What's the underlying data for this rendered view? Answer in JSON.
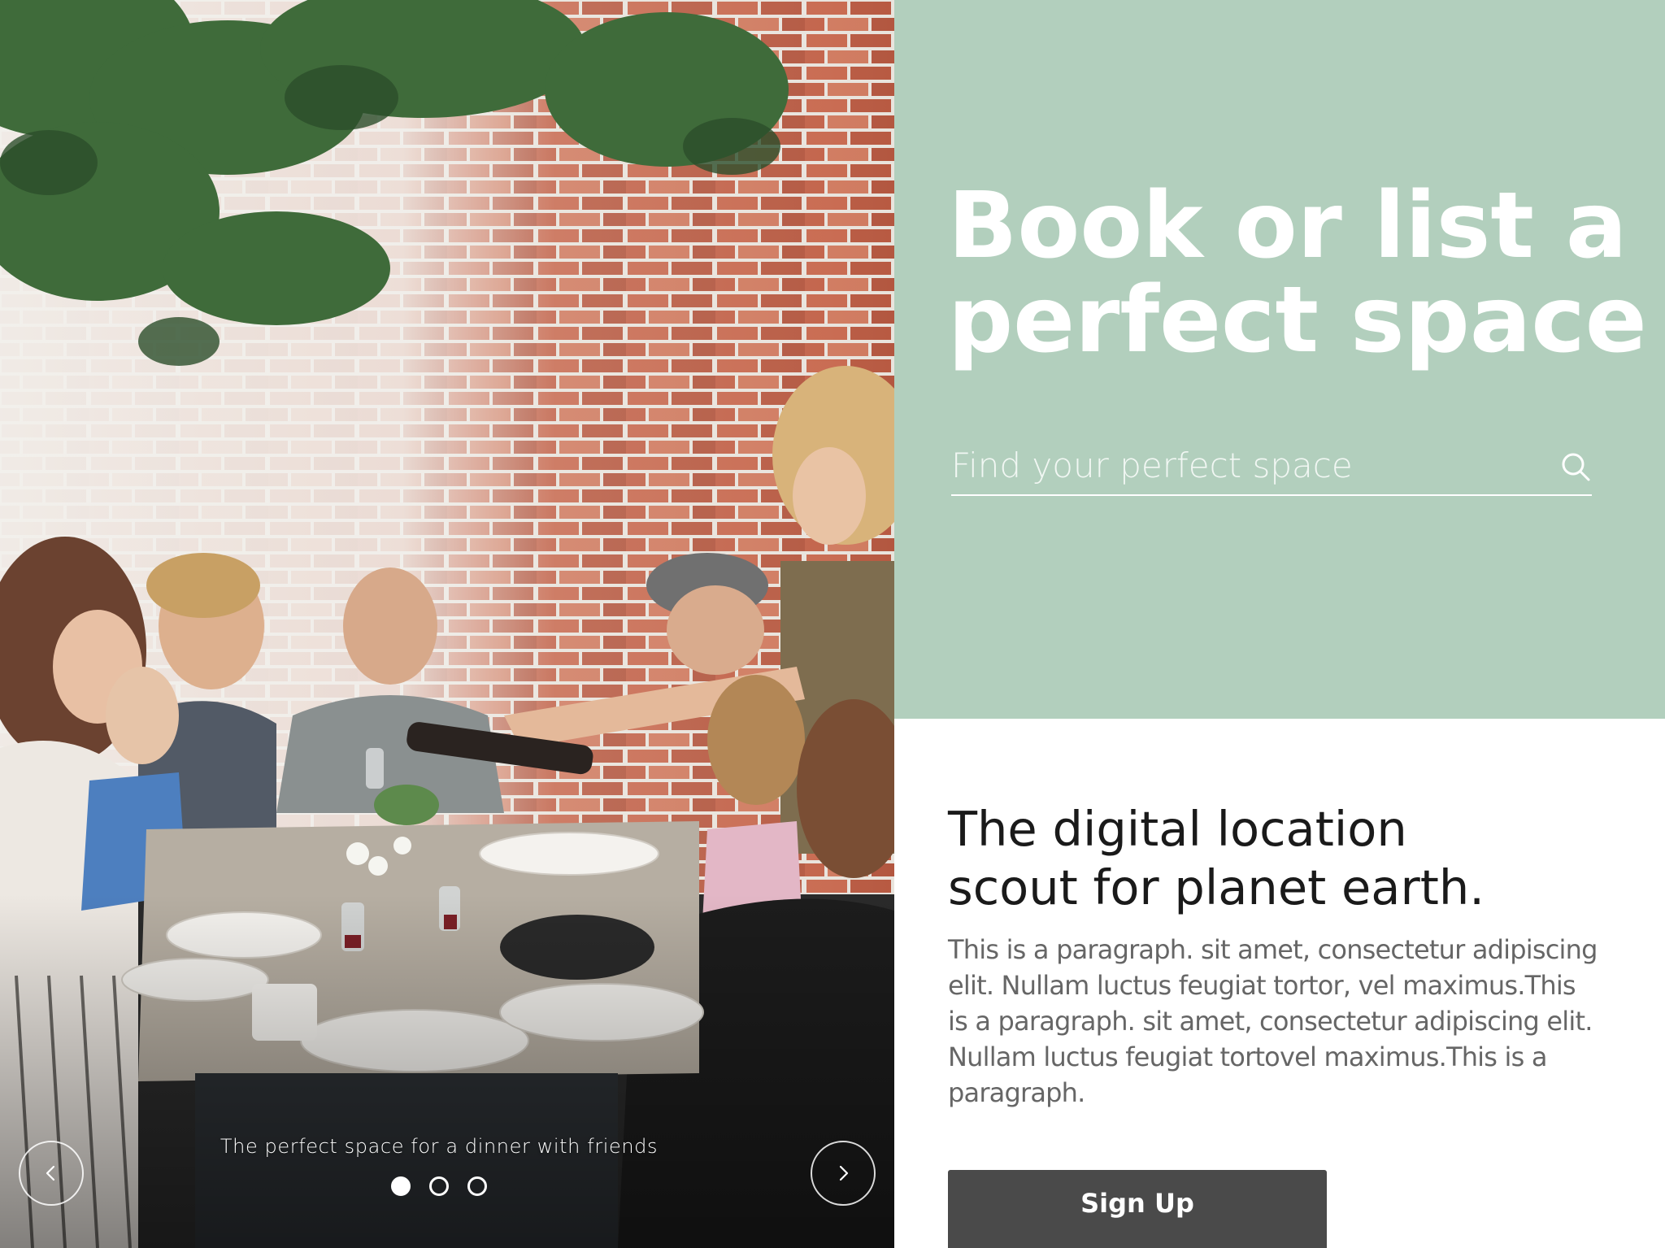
{
  "slideshow": {
    "caption": "The perfect space for a dinner with friends",
    "slide_count": 3,
    "active_slide": 1
  },
  "hero": {
    "title_line1": "Book or list a",
    "title_line2": "perfect space",
    "search_placeholder": "Find your perfect space",
    "background_color": "#b2cfbd"
  },
  "content": {
    "tagline_line1": "The digital location",
    "tagline_line2": "scout for planet earth.",
    "paragraph": "This is a paragraph. sit amet, consectetur adipiscing elit. Nullam luctus feugiat tortor, vel maximus.This is a paragraph. sit amet, consectetur adipiscing elit. Nullam luctus feugiat tortovel maximus.This is a paragraph.",
    "signup_label": "Sign Up"
  }
}
